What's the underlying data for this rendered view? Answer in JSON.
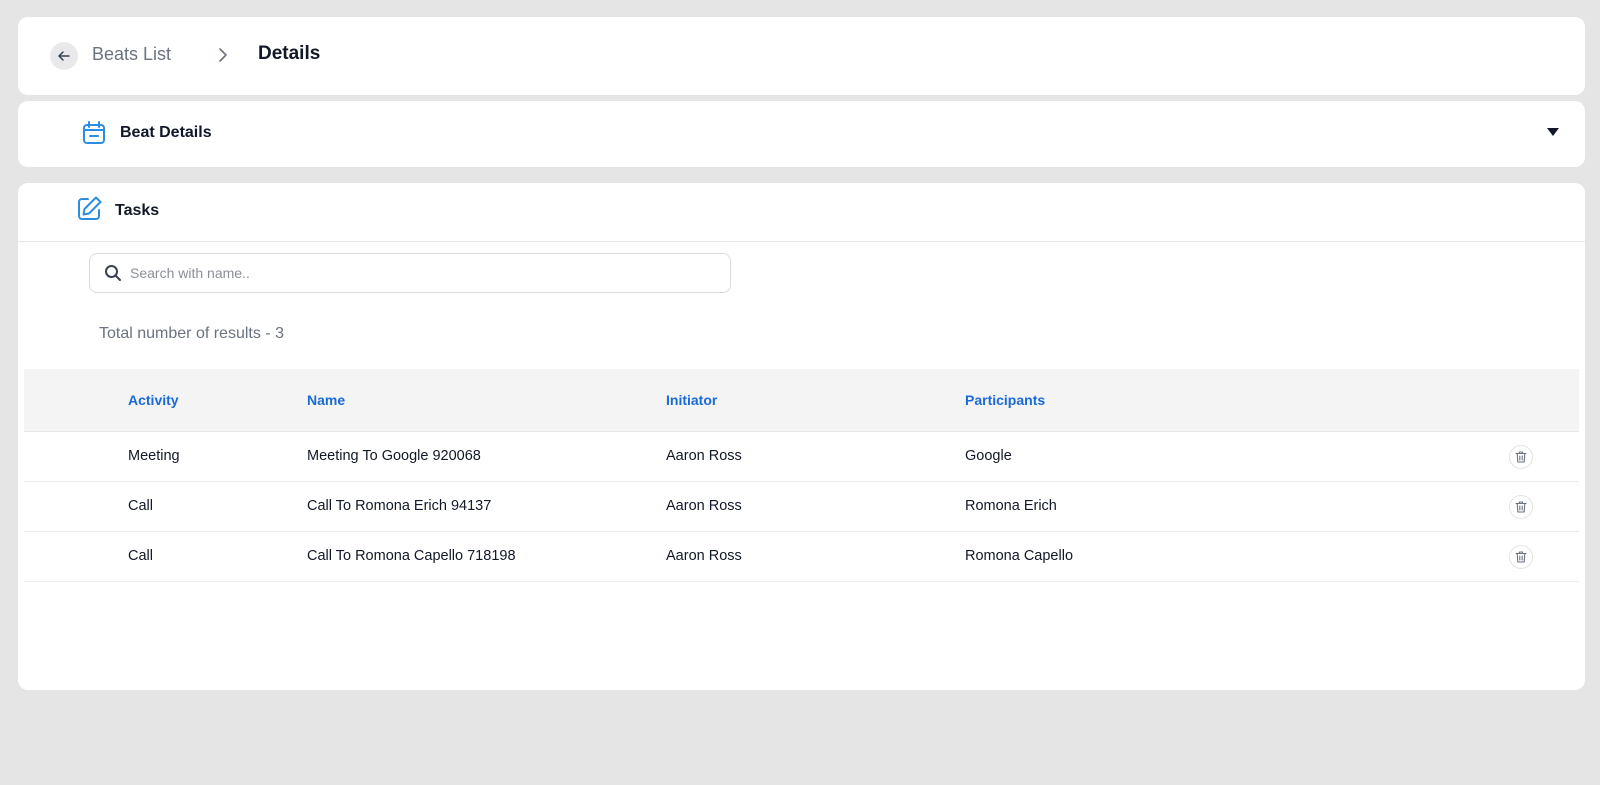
{
  "breadcrumb": {
    "back_icon": "arrow-left-icon",
    "parent_label": "Beats List",
    "separator_icon": "chevron-right-icon",
    "current_label": "Details"
  },
  "beat_section": {
    "icon": "calendar-icon",
    "title": "Beat Details",
    "toggle_icon": "caret-down-icon",
    "expanded": false
  },
  "tasks_section": {
    "icon": "edit-icon",
    "title": "Tasks",
    "search": {
      "icon": "search-icon",
      "placeholder": "Search with name..",
      "value": ""
    },
    "results_text": "Total number of results - 3",
    "table": {
      "columns": [
        "Activity",
        "Name",
        "Initiator",
        "Participants"
      ],
      "rows": [
        {
          "activity": "Meeting",
          "name": "Meeting To Google 920068",
          "initiator": "Aaron Ross",
          "participants": "Google",
          "action_icon": "trash-icon"
        },
        {
          "activity": "Call",
          "name": "Call To Romona Erich 94137",
          "initiator": "Aaron Ross",
          "participants": "Romona Erich",
          "action_icon": "trash-icon"
        },
        {
          "activity": "Call",
          "name": "Call To Romona Capello 718198",
          "initiator": "Aaron Ross",
          "participants": "Romona Capello",
          "action_icon": "trash-icon"
        }
      ]
    }
  },
  "colors": {
    "page_bg": "#e5e5e5",
    "card_bg": "#ffffff",
    "accent_blue": "#1a6ad8",
    "icon_blue": "#2d8ee0",
    "muted_text": "#6b7280"
  }
}
